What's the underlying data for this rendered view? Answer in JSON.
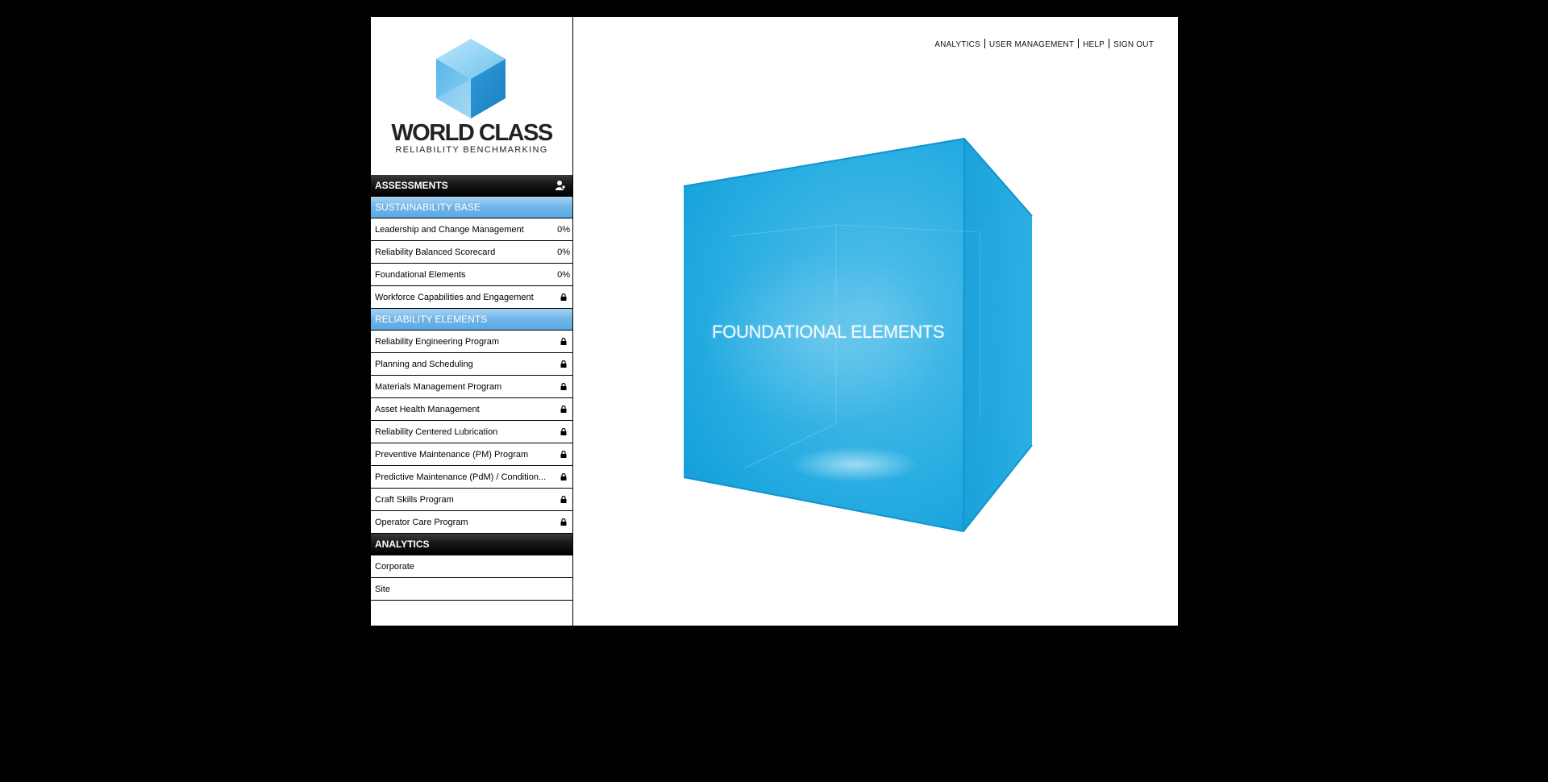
{
  "brand": {
    "title": "WORLD CLASS",
    "subtitle": "RELIABILITY BENCHMARKING"
  },
  "top_nav": [
    {
      "label": "ANALYTICS"
    },
    {
      "label": "USER MANAGEMENT"
    },
    {
      "label": "HELP"
    },
    {
      "label": "SIGN OUT"
    }
  ],
  "sidebar": {
    "assessments_header": "ASSESSMENTS",
    "sustainability": {
      "header": "SUSTAINABILITY BASE",
      "items": [
        {
          "label": "Leadership and Change Management",
          "value": "0%"
        },
        {
          "label": "Reliability Balanced Scorecard",
          "value": "0%"
        },
        {
          "label": "Foundational Elements",
          "value": "0%"
        },
        {
          "label": "Workforce Capabilities and Engagement",
          "icon": "lock-icon"
        }
      ]
    },
    "reliability": {
      "header": "RELIABILITY ELEMENTS",
      "items": [
        {
          "label": "Reliability Engineering Program",
          "icon": "lock-icon"
        },
        {
          "label": "Planning and Scheduling",
          "icon": "lock-icon"
        },
        {
          "label": "Materials Management Program",
          "icon": "lock-icon"
        },
        {
          "label": "Asset Health Management",
          "icon": "lock-icon"
        },
        {
          "label": "Reliability Centered Lubrication",
          "icon": "lock-icon"
        },
        {
          "label": "Preventive Maintenance (PM) Program",
          "icon": "lock-icon"
        },
        {
          "label": "Predictive Maintenance (PdM) / Condition...",
          "icon": "lock-icon"
        },
        {
          "label": "Craft Skills Program",
          "icon": "lock-icon"
        },
        {
          "label": "Operator Care Program",
          "icon": "lock-icon"
        }
      ]
    },
    "analytics": {
      "header": "ANALYTICS",
      "items": [
        {
          "label": "Corporate"
        },
        {
          "label": "Site"
        }
      ]
    }
  },
  "main": {
    "cube_label": "FOUNDATIONAL ELEMENTS"
  },
  "colors": {
    "page_background": "#000000",
    "cube_blue": "#1aa3dc",
    "section_blue": "#6fb4e8"
  }
}
